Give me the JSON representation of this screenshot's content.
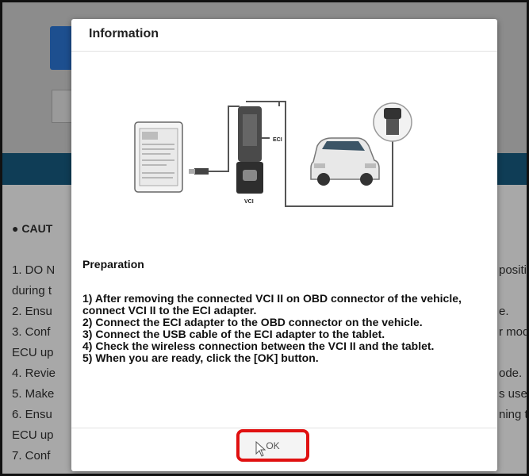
{
  "background": {
    "caution_heading": "CAUT",
    "lines_left": [
      "1. DO N",
      "during t",
      "2. Ensu",
      "3. Conf",
      "ECU up",
      "4. Revie",
      "5. Make",
      "6. Ensu",
      "ECU up",
      "7. Conf"
    ],
    "lines_right": [
      "position",
      "e.",
      "r mode",
      "ode.",
      "s used.",
      "ning the"
    ]
  },
  "dialog": {
    "title": "Information",
    "illustration": {
      "eci_label": "ECI",
      "vci_label": "VCI"
    },
    "preparation_title": "Preparation",
    "steps": [
      "1) After removing the connected VCI II on OBD connector of the vehicle, connect VCI II to the ECI adapter.",
      "2) Connect the ECI adapter to the OBD connector on the vehicle.",
      "3) Connect the USB cable of the ECI adapter to the tablet.",
      "4) Check the wireless connection between the VCI II and the tablet.",
      "5) When you are ready, click the [OK] button."
    ],
    "ok_label": "OK"
  },
  "colors": {
    "highlight": "#e01010",
    "band": "#0f3d56"
  }
}
